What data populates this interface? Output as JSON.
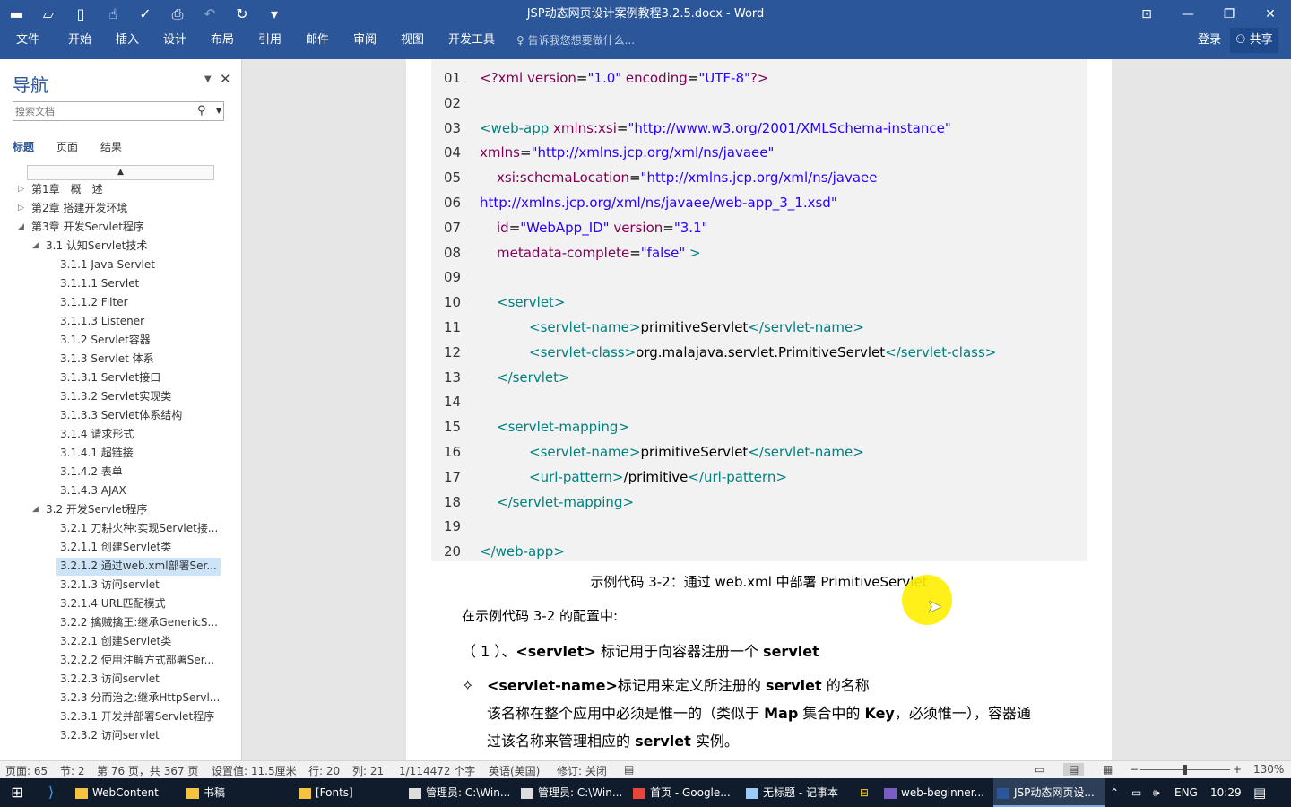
{
  "window": {
    "title": "JSP动态网页设计案例教程3.2.5.docx - Word",
    "qat_icons": [
      "save-icon",
      "open-icon",
      "new-icon",
      "touch-mode-icon",
      "spelling-icon",
      "print-preview-icon",
      "undo-icon",
      "redo-icon",
      "customize-qat-icon"
    ],
    "controls": [
      "ribbon-display-options-icon",
      "minimize-icon",
      "restore-icon",
      "close-icon"
    ]
  },
  "ribbon": {
    "tabs": [
      "文件",
      "开始",
      "插入",
      "设计",
      "布局",
      "引用",
      "邮件",
      "审阅",
      "视图",
      "开发工具"
    ],
    "tell_me": "告诉我您想要做什么...",
    "login": "登录",
    "share": "共享"
  },
  "nav": {
    "title": "导航",
    "search_placeholder": "搜索文档",
    "tabs": [
      "标题",
      "页面",
      "结果"
    ],
    "items": [
      {
        "label": "第1章　概　述",
        "level": 0,
        "expander": "collapsed"
      },
      {
        "label": "第2章 搭建开发环境",
        "level": 0,
        "expander": "collapsed"
      },
      {
        "label": "第3章 开发Servlet程序",
        "level": 0,
        "expander": "expanded"
      },
      {
        "label": "3.1  认知Servlet技术",
        "level": 1,
        "expander": "expanded"
      },
      {
        "label": "3.1.1 Java Servlet",
        "level": 2
      },
      {
        "label": "3.1.1.1 Servlet",
        "level": 2
      },
      {
        "label": "3.1.1.2 Filter",
        "level": 2
      },
      {
        "label": "3.1.1.3 Listener",
        "level": 2
      },
      {
        "label": "3.1.2 Servlet容器",
        "level": 2
      },
      {
        "label": "3.1.3 Servlet 体系",
        "level": 2
      },
      {
        "label": "3.1.3.1 Servlet接口",
        "level": 2
      },
      {
        "label": "3.1.3.2 Servlet实现类",
        "level": 2
      },
      {
        "label": "3.1.3.3 Servlet体系结构",
        "level": 2
      },
      {
        "label": "3.1.4 请求形式",
        "level": 2
      },
      {
        "label": "3.1.4.1 超链接",
        "level": 2
      },
      {
        "label": "3.1.4.2 表单",
        "level": 2
      },
      {
        "label": "3.1.4.3 AJAX",
        "level": 2
      },
      {
        "label": "3.2  开发Servlet程序",
        "level": 1,
        "expander": "expanded"
      },
      {
        "label": "3.2.1 刀耕火种:实现Servlet接...",
        "level": 2
      },
      {
        "label": "3.2.1.1 创建Servlet类",
        "level": 2
      },
      {
        "label": "3.2.1.2 通过web.xml部署Ser...",
        "level": 2,
        "selected": true
      },
      {
        "label": "3.2.1.3 访问servlet",
        "level": 2
      },
      {
        "label": "3.2.1.4 URL匹配模式",
        "level": 2
      },
      {
        "label": "3.2.2 擒贼擒王:继承GenericS...",
        "level": 2
      },
      {
        "label": "3.2.2.1 创建Servlet类",
        "level": 2
      },
      {
        "label": "3.2.2.2 使用注解方式部署Ser...",
        "level": 2
      },
      {
        "label": "3.2.2.3 访问servlet",
        "level": 2
      },
      {
        "label": "3.2.3 分而治之:继承HttpServl...",
        "level": 2
      },
      {
        "label": "3.2.3.1 开发并部署Servlet程序",
        "level": 2
      },
      {
        "label": "3.2.3.2 访问servlet",
        "level": 2
      }
    ]
  },
  "document": {
    "code_lines": [
      {
        "n": "01",
        "indent": 0,
        "segs": [
          [
            "a",
            "<?xml "
          ],
          [
            "a",
            "version"
          ],
          [
            "x",
            "="
          ],
          [
            "v",
            "\"1.0\""
          ],
          [
            "a",
            " encoding"
          ],
          [
            "x",
            "="
          ],
          [
            "v",
            "\"UTF-8\""
          ],
          [
            "a",
            "?>"
          ]
        ]
      },
      {
        "n": "02",
        "indent": 0,
        "segs": []
      },
      {
        "n": "03",
        "indent": 0,
        "segs": [
          [
            "t",
            "<web-app "
          ],
          [
            "a",
            "xmlns:xsi"
          ],
          [
            "x",
            "="
          ],
          [
            "v",
            "\"http://www.w3.org/2001/XMLSchema-instance\""
          ]
        ]
      },
      {
        "n": "04",
        "indent": 0,
        "segs": [
          [
            "a",
            "xmlns"
          ],
          [
            "x",
            "="
          ],
          [
            "v",
            "\"http://xmlns.jcp.org/xml/ns/javaee\""
          ]
        ]
      },
      {
        "n": "05",
        "indent": 1,
        "segs": [
          [
            "a",
            "xsi:schemaLocation"
          ],
          [
            "x",
            "="
          ],
          [
            "v",
            "\"http://xmlns.jcp.org/xml/ns/javaee"
          ]
        ]
      },
      {
        "n": "06",
        "indent": 0,
        "segs": [
          [
            "v",
            "http://xmlns.jcp.org/xml/ns/javaee/web-app_3_1.xsd\""
          ]
        ]
      },
      {
        "n": "07",
        "indent": 1,
        "segs": [
          [
            "a",
            "id"
          ],
          [
            "x",
            "="
          ],
          [
            "v",
            "\"WebApp_ID\""
          ],
          [
            "a",
            " version"
          ],
          [
            "x",
            "="
          ],
          [
            "v",
            "\"3.1\""
          ]
        ]
      },
      {
        "n": "08",
        "indent": 1,
        "segs": [
          [
            "a",
            "metadata-complete"
          ],
          [
            "x",
            "="
          ],
          [
            "v",
            "\"false\""
          ],
          [
            "t",
            " >"
          ]
        ]
      },
      {
        "n": "09",
        "indent": 0,
        "segs": []
      },
      {
        "n": "10",
        "indent": 1,
        "segs": [
          [
            "t",
            "<servlet>"
          ]
        ]
      },
      {
        "n": "11",
        "indent": 2,
        "segs": [
          [
            "t",
            "<servlet-name>"
          ],
          [
            "x",
            "primitiveServlet"
          ],
          [
            "t",
            "</servlet-name>"
          ]
        ]
      },
      {
        "n": "12",
        "indent": 2,
        "segs": [
          [
            "t",
            "<servlet-class>"
          ],
          [
            "x",
            "org.malajava.servlet.PrimitiveServlet"
          ],
          [
            "t",
            "</servlet-class>"
          ]
        ]
      },
      {
        "n": "13",
        "indent": 1,
        "segs": [
          [
            "t",
            "</servlet>"
          ]
        ]
      },
      {
        "n": "14",
        "indent": 0,
        "segs": []
      },
      {
        "n": "15",
        "indent": 1,
        "segs": [
          [
            "t",
            "<servlet-mapping>"
          ]
        ]
      },
      {
        "n": "16",
        "indent": 2,
        "segs": [
          [
            "t",
            "<servlet-name>"
          ],
          [
            "x",
            "primitiveServlet"
          ],
          [
            "t",
            "</servlet-name>"
          ]
        ]
      },
      {
        "n": "17",
        "indent": 2,
        "segs": [
          [
            "t",
            "<url-pattern>"
          ],
          [
            "x",
            "/primitive"
          ],
          [
            "t",
            "</url-pattern>"
          ]
        ]
      },
      {
        "n": "18",
        "indent": 1,
        "segs": [
          [
            "t",
            "</servlet-mapping>"
          ]
        ]
      },
      {
        "n": "19",
        "indent": 0,
        "segs": []
      },
      {
        "n": "20",
        "indent": 0,
        "segs": [
          [
            "t",
            "</web-app>"
          ]
        ]
      }
    ],
    "caption": "示例代码  3-2：通过 web.xml 中部署 PrimitiveServlet",
    "para1": "在示例代码  3-2 的配置中:",
    "para2_prefix": "（ 1 ）、",
    "para2_tag": "<servlet>",
    "para2_mid": " 标记用于向容器注册一个 ",
    "para2_word": "servlet",
    "bullet_symbol": "✧",
    "bullet_tag": "<servlet-name>",
    "bullet_mid": "标记用来定义所注册的 ",
    "bullet_word": "servlet",
    "bullet_end": " 的名称",
    "para3_line1_a": "该名称在整个应用中必须是惟一的（类似于 ",
    "para3_map": "Map",
    "para3_line1_b": " 集合中的 ",
    "para3_key": "Key",
    "para3_line1_c": "，必须惟一），容器通",
    "para3_line2_a": "过该名称来管理相应的 ",
    "para3_line2_word": "servlet",
    "para3_line2_b": " 实例。"
  },
  "status": {
    "page": "页面: 65",
    "section": "节: 2",
    "page_of": "第 76 页，共 367 页",
    "setting": "设置值: 11.5厘米",
    "line": "行: 20",
    "col": "列: 21",
    "words": "1/114472 个字",
    "lang": "英语(美国)",
    "track": "修订: 关闭",
    "zoom": "130%",
    "view_icons": [
      "read-mode-icon",
      "print-layout-icon",
      "web-layout-icon"
    ],
    "zoom_minus": "−",
    "zoom_plus": "+",
    "zoom_level": 0.5
  },
  "taskbar": {
    "items": [
      {
        "label": "WebContent",
        "icon": "folder-icon"
      },
      {
        "label": "书稿",
        "icon": "folder-icon"
      },
      {
        "label": "[Fonts]",
        "icon": "folder-icon"
      },
      {
        "label": "管理员: C:\\Win...",
        "icon": "cmd-icon"
      },
      {
        "label": "管理员: C:\\Win...",
        "icon": "cmd-icon"
      },
      {
        "label": "首页 - Google...",
        "icon": "chrome-icon"
      },
      {
        "label": "无标题 - 记事本",
        "icon": "notepad-icon"
      },
      {
        "label": "web-beginner...",
        "icon": "eclipse-icon"
      },
      {
        "label": "JSP动态网页设...",
        "icon": "word-icon",
        "active": true
      }
    ],
    "tray_lang": "ENG",
    "clock": "10:29",
    "pinned_icons": [
      "windows-start-icon",
      "vscode-icon",
      "task-app-icon"
    ]
  }
}
